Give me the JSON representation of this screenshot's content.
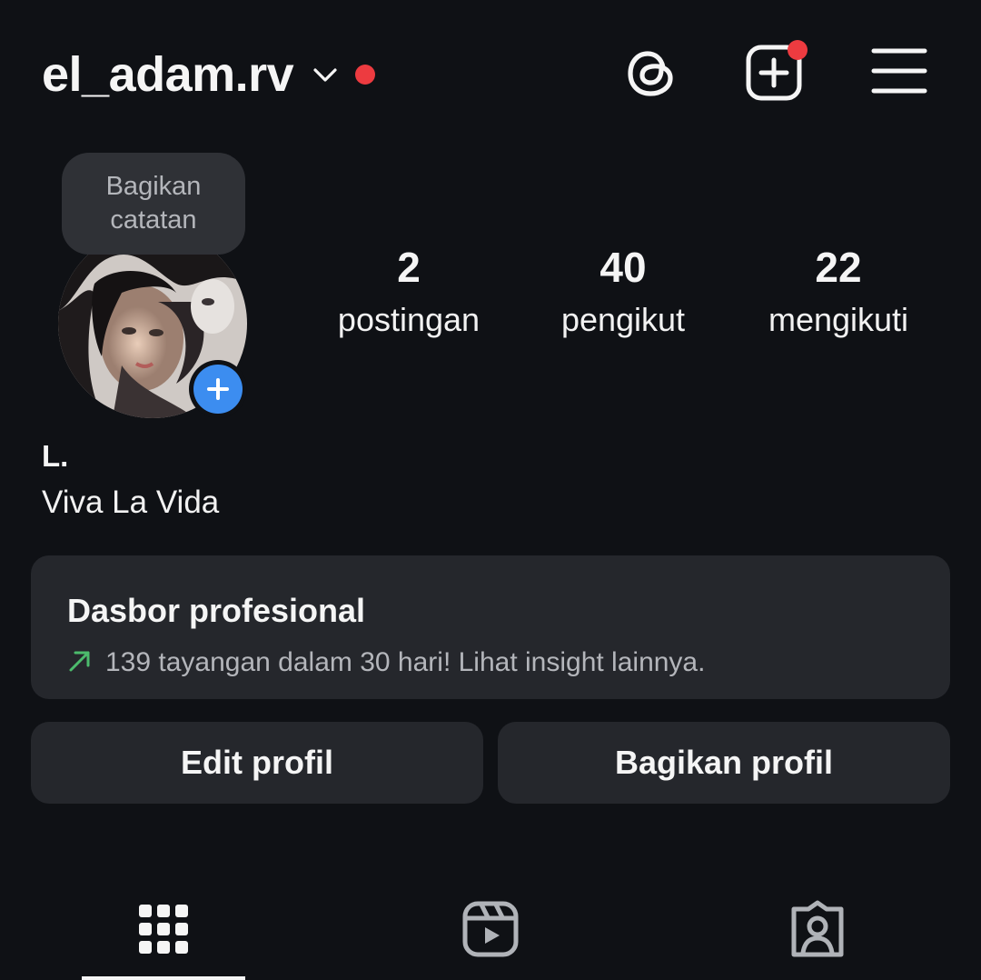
{
  "header": {
    "username": "el_adam.rv",
    "icons": {
      "switch_account": "chevron-down-icon",
      "threads": "threads-icon",
      "create": "create-plus-icon",
      "menu": "hamburger-menu-icon"
    }
  },
  "note": {
    "text": "Bagikan catatan"
  },
  "profile": {
    "display_name": "L.",
    "bio": "Viva La Vida"
  },
  "stats": {
    "posts": {
      "count": "2",
      "label": "postingan"
    },
    "followers": {
      "count": "40",
      "label": "pengikut"
    },
    "following": {
      "count": "22",
      "label": "mengikuti"
    }
  },
  "dashboard": {
    "title": "Dasbor profesional",
    "subtitle": "139 tayangan dalam 30 hari! Lihat insight lainnya.",
    "icon": "trend-up-arrow-icon"
  },
  "buttons": {
    "edit": "Edit profil",
    "share": "Bagikan profil"
  },
  "tabs": [
    {
      "name": "posts-grid",
      "icon": "grid-icon",
      "active": true
    },
    {
      "name": "reels",
      "icon": "reels-icon",
      "active": false
    },
    {
      "name": "tagged",
      "icon": "tagged-person-icon",
      "active": false
    }
  ],
  "colors": {
    "background": "#0f1115",
    "surface": "#25272c",
    "notification": "#ed3b40",
    "accent_blue": "#3c8df0",
    "trend_green": "#4cbb6c",
    "secondary_text": "#b4b6bb"
  }
}
